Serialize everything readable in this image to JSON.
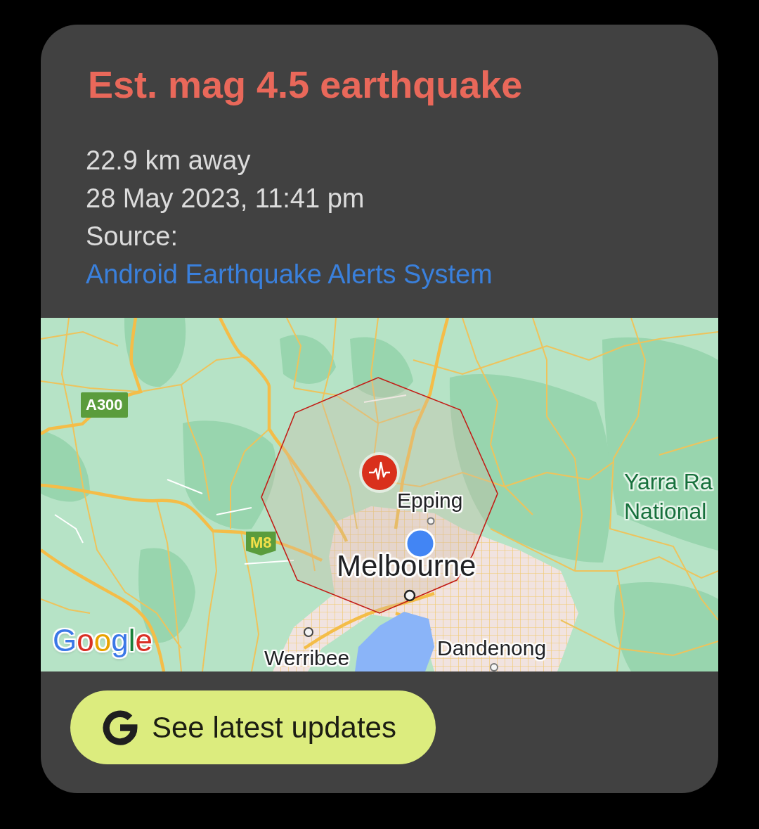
{
  "alert": {
    "title": "Est. mag 4.5 earthquake",
    "distance": "22.9 km away",
    "time": "28 May 2023, 11:41 pm",
    "source_label": "Source:",
    "source_link": "Android Earthquake Alerts System"
  },
  "map": {
    "labels": [
      {
        "kind": "shield_route",
        "text": "A300"
      },
      {
        "kind": "shield_motorway",
        "text": "M8"
      },
      {
        "kind": "park",
        "text": "Yarra Ra"
      },
      {
        "kind": "park",
        "text": "National"
      },
      {
        "kind": "town",
        "text": "Epping"
      },
      {
        "kind": "city",
        "text": "Melbourne"
      },
      {
        "kind": "town",
        "text": "Werribee"
      },
      {
        "kind": "town",
        "text": "Dandenong"
      }
    ],
    "attribution": "Google"
  },
  "button": {
    "label": "See latest updates"
  }
}
